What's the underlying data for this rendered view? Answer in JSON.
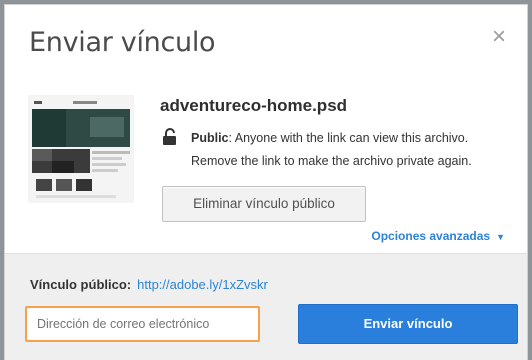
{
  "dialog": {
    "title": "Enviar vínculo",
    "close_icon": "close-icon"
  },
  "file": {
    "name": "adventureco-home.psd",
    "thumbnail_icon": "psd-thumbnail"
  },
  "access": {
    "lock_icon": "lock-open-icon",
    "label": "Public",
    "description_line1": ": Anyone with the link can view this archivo.",
    "description_line2": "Remove the link to make the archivo private again.",
    "remove_button": "Eliminar vínculo público"
  },
  "advanced": {
    "label": "Opciones avanzadas",
    "caret": "▼"
  },
  "footer": {
    "public_link_label": "Vínculo público:",
    "public_link_url": "http://adobe.ly/1xZvskr",
    "email_placeholder": "Dirección de correo electrónico",
    "send_button": "Enviar vínculo"
  },
  "colors": {
    "accent": "#2a7fdc",
    "link": "#2d83d6",
    "focus_border": "#f5a150"
  }
}
